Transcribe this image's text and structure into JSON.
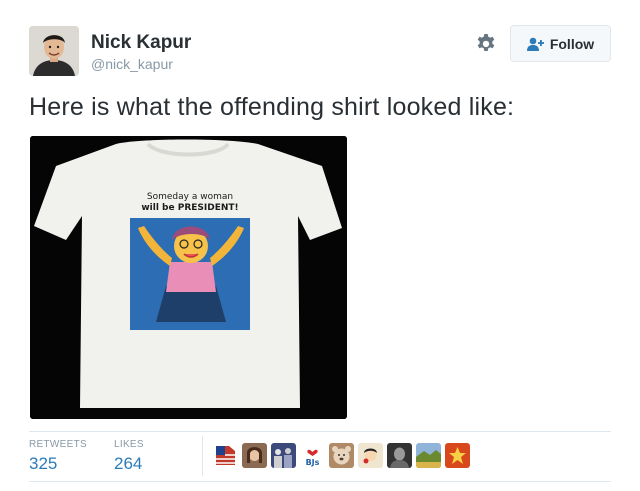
{
  "user": {
    "name": "Nick Kapur",
    "handle": "@nick_kapur"
  },
  "follow_label": "Follow",
  "tweet_text": "Here is what the offending shirt looked like:",
  "shirt": {
    "line1": "Someday a woman",
    "line2": "will be PRESIDENT!"
  },
  "stats": {
    "retweets_label": "RETWEETS",
    "retweets_value": "325",
    "likes_label": "LIKES",
    "likes_value": "264"
  },
  "likers": [
    {
      "icon": "flag-avatar",
      "color": "#c0392b"
    },
    {
      "icon": "woman-avatar",
      "color": "#8a6a52"
    },
    {
      "icon": "crowd-avatar",
      "color": "#3b4a7a"
    },
    {
      "icon": "bjs-logo-avatar",
      "label": "BJs",
      "color": "#1f5fa8"
    },
    {
      "icon": "bear-avatar",
      "color": "#b08a66"
    },
    {
      "icon": "cartoon-avatar",
      "color": "#f0e6cf"
    },
    {
      "icon": "portrait-avatar",
      "color": "#333333"
    },
    {
      "icon": "landscape-avatar",
      "color": "#6b8a2f"
    },
    {
      "icon": "emblem-avatar",
      "color": "#d9481c"
    }
  ],
  "colors": {
    "link": "#2b7bb9",
    "muted": "#8899a6",
    "text": "#292f33",
    "border": "#e1e8ed",
    "shirt_panel": "#2d6db3",
    "shirt_pink": "#e98fb7"
  }
}
